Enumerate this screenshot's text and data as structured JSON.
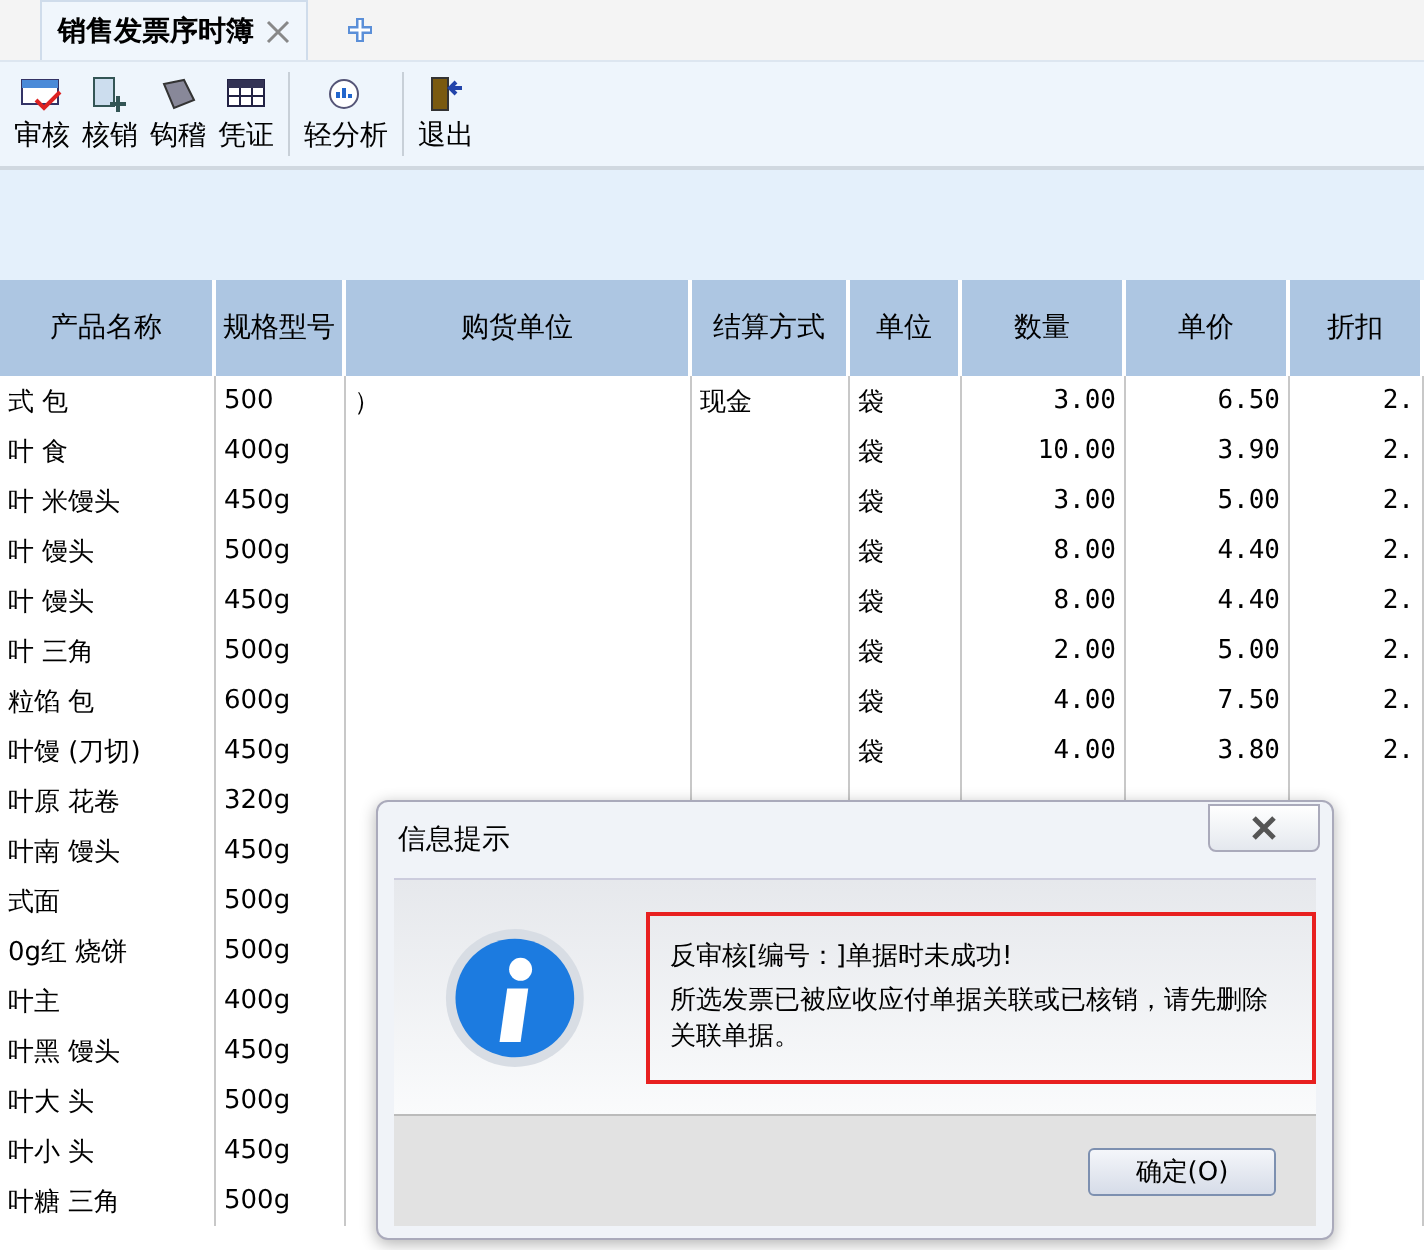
{
  "tabs": [
    {
      "label": "销售发票序时簿",
      "selected": true
    }
  ],
  "toolbar": [
    "审核",
    "核销",
    "钩稽",
    "凭证",
    "轻分析",
    "退出"
  ],
  "table": {
    "columns": [
      "产品名称",
      "规格型号",
      "购货单位",
      "结算方式",
      "单位",
      "数量",
      "单价",
      "折扣"
    ],
    "rows": [
      [
        "式 包",
        "500",
        "）",
        "现金",
        "袋",
        "3.00",
        "6.50",
        "2."
      ],
      [
        "叶 食",
        "400g",
        "",
        "",
        "袋",
        "10.00",
        "3.90",
        "2."
      ],
      [
        "叶 米馒头",
        "450g",
        "",
        "",
        "袋",
        "3.00",
        "5.00",
        "2."
      ],
      [
        "叶 馒头",
        "500g",
        "",
        "",
        "袋",
        "8.00",
        "4.40",
        "2."
      ],
      [
        "叶 馒头",
        "450g",
        "",
        "",
        "袋",
        "8.00",
        "4.40",
        "2."
      ],
      [
        "叶 三角",
        "500g",
        "",
        "",
        "袋",
        "2.00",
        "5.00",
        "2."
      ],
      [
        "粒馅 包",
        "600g",
        "",
        "",
        "袋",
        "4.00",
        "7.50",
        "2."
      ],
      [
        "叶馒 (刀切)",
        "450g",
        "",
        "",
        "袋",
        "4.00",
        "3.80",
        "2."
      ],
      [
        "叶原 花卷",
        "320g",
        "",
        "",
        "",
        "",
        "",
        ""
      ],
      [
        "叶南 馒头",
        "450g",
        "",
        "",
        "",
        "",
        "",
        ""
      ],
      [
        "式面",
        "500g",
        "",
        "",
        "",
        "",
        "",
        ""
      ],
      [
        "0g红 烧饼",
        "500g",
        "",
        "",
        "",
        "",
        "",
        ""
      ],
      [
        "叶主",
        "400g",
        "",
        "",
        "",
        "",
        "",
        ""
      ],
      [
        "叶黑 馒头",
        "450g",
        "",
        "",
        "",
        "",
        "",
        ""
      ],
      [
        "叶大 头",
        "500g",
        "",
        "",
        "",
        "",
        "",
        ""
      ],
      [
        "叶小 头",
        "450g",
        "",
        "",
        "",
        "",
        "",
        ""
      ],
      [
        "叶糖 三角",
        "500g",
        "",
        "",
        "",
        "",
        "",
        ""
      ]
    ]
  },
  "dialog": {
    "title": "信息提示",
    "messages": [
      "反审核[编号：]单据时未成功!",
      "所选发票已被应收应付单据关联或已核销，请先删除关联单据。"
    ],
    "button": "确定(O)"
  }
}
